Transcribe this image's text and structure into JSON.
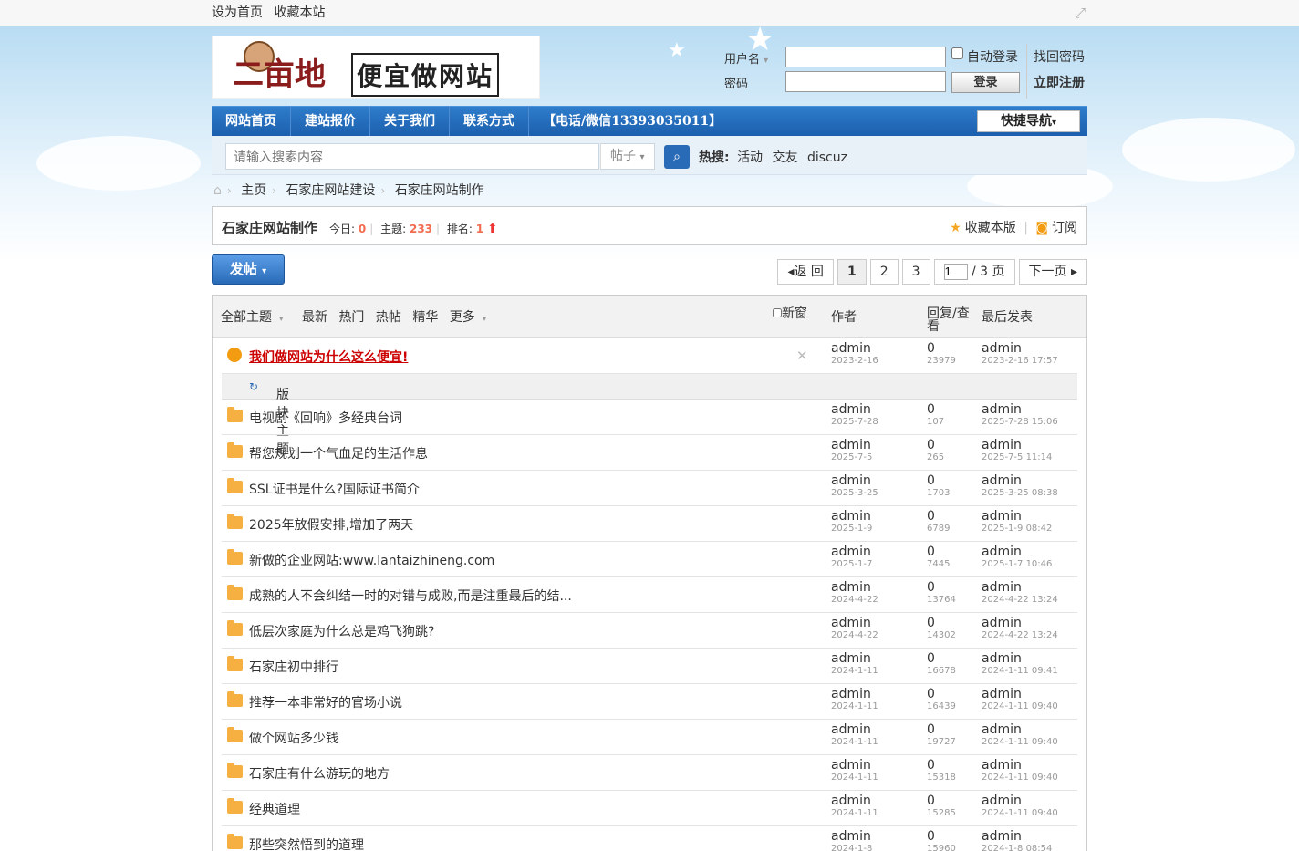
{
  "topbar": {
    "set_home": "设为首页",
    "bookmark": "收藏本站"
  },
  "logo": {
    "brand": "二亩地",
    "slogan": "便宜做网站"
  },
  "login": {
    "username_label": "用户名",
    "password_label": "密码",
    "auto_login": "自动登录",
    "login_button": "登录",
    "find_password": "找回密码",
    "register": "立即注册"
  },
  "nav": {
    "items": [
      "网站首页",
      "建站报价",
      "关于我们",
      "联系方式",
      "【电话/微信13393035011】"
    ],
    "quick": "快捷导航"
  },
  "search": {
    "placeholder": "请输入搜索内容",
    "type": "帖子",
    "hot_label": "热搜:",
    "hot_items": [
      "活动",
      "交友",
      "discuz"
    ]
  },
  "breadcrumb": [
    "主页",
    "石家庄网站建设",
    "石家庄网站制作"
  ],
  "forum": {
    "title": "石家庄网站制作",
    "today_label": "今日:",
    "today": "0",
    "topics_label": "主题:",
    "topics": "233",
    "rank_label": "排名:",
    "rank": "1",
    "favorite": "收藏本版",
    "subscribe": "订阅"
  },
  "toolbar": {
    "post_button": "发帖"
  },
  "pager": {
    "back": "返 回",
    "pages": [
      "1",
      "2",
      "3"
    ],
    "current": "1",
    "total": "/ 3 页",
    "next": "下一页"
  },
  "threads_header": {
    "filters": [
      "全部主题",
      "最新",
      "热门",
      "热帖",
      "精华",
      "更多"
    ],
    "new_window": "新窗",
    "author": "作者",
    "reply_view": "回复/查看",
    "last_post": "最后发表"
  },
  "sticky": {
    "title": "我们做网站为什么这么便宜!",
    "author": "admin",
    "date": "2023-2-16",
    "replies": "0",
    "views": "23979",
    "last_author": "admin",
    "last_time": "2023-2-16 17:57"
  },
  "section_label": "版块主题",
  "threads": [
    {
      "title": "电视剧《回响》多经典台词",
      "author": "admin",
      "date": "2025-7-28",
      "replies": "0",
      "views": "107",
      "last_author": "admin",
      "last_time": "2025-7-28 15:06"
    },
    {
      "title": "帮您规划一个气血足的生活作息",
      "author": "admin",
      "date": "2025-7-5",
      "replies": "0",
      "views": "265",
      "last_author": "admin",
      "last_time": "2025-7-5 11:14"
    },
    {
      "title": "SSL证书是什么?国际证书简介",
      "author": "admin",
      "date": "2025-3-25",
      "replies": "0",
      "views": "1703",
      "last_author": "admin",
      "last_time": "2025-3-25 08:38"
    },
    {
      "title": "2025年放假安排,增加了两天",
      "author": "admin",
      "date": "2025-1-9",
      "replies": "0",
      "views": "6789",
      "last_author": "admin",
      "last_time": "2025-1-9 08:42"
    },
    {
      "title": "新做的企业网站:www.lantaizhineng.com",
      "author": "admin",
      "date": "2025-1-7",
      "replies": "0",
      "views": "7445",
      "last_author": "admin",
      "last_time": "2025-1-7 10:46"
    },
    {
      "title": "成熟的人不会纠结一时的对错与成败,而是注重最后的结...",
      "author": "admin",
      "date": "2024-4-22",
      "replies": "0",
      "views": "13764",
      "last_author": "admin",
      "last_time": "2024-4-22 13:24"
    },
    {
      "title": "低层次家庭为什么总是鸡飞狗跳?",
      "author": "admin",
      "date": "2024-4-22",
      "replies": "0",
      "views": "14302",
      "last_author": "admin",
      "last_time": "2024-4-22 13:24"
    },
    {
      "title": "石家庄初中排行",
      "author": "admin",
      "date": "2024-1-11",
      "replies": "0",
      "views": "16678",
      "last_author": "admin",
      "last_time": "2024-1-11 09:41"
    },
    {
      "title": "推荐一本非常好的官场小说",
      "author": "admin",
      "date": "2024-1-11",
      "replies": "0",
      "views": "16439",
      "last_author": "admin",
      "last_time": "2024-1-11 09:40"
    },
    {
      "title": "做个网站多少钱",
      "author": "admin",
      "date": "2024-1-11",
      "replies": "0",
      "views": "19727",
      "last_author": "admin",
      "last_time": "2024-1-11 09:40"
    },
    {
      "title": "石家庄有什么游玩的地方",
      "author": "admin",
      "date": "2024-1-11",
      "replies": "0",
      "views": "15318",
      "last_author": "admin",
      "last_time": "2024-1-11 09:40"
    },
    {
      "title": "经典道理",
      "author": "admin",
      "date": "2024-1-11",
      "replies": "0",
      "views": "15285",
      "last_author": "admin",
      "last_time": "2024-1-11 09:40"
    },
    {
      "title": "那些突然悟到的道理",
      "author": "admin",
      "date": "2024-1-8",
      "replies": "0",
      "views": "15960",
      "last_author": "admin",
      "last_time": "2024-1-8 08:54"
    }
  ]
}
